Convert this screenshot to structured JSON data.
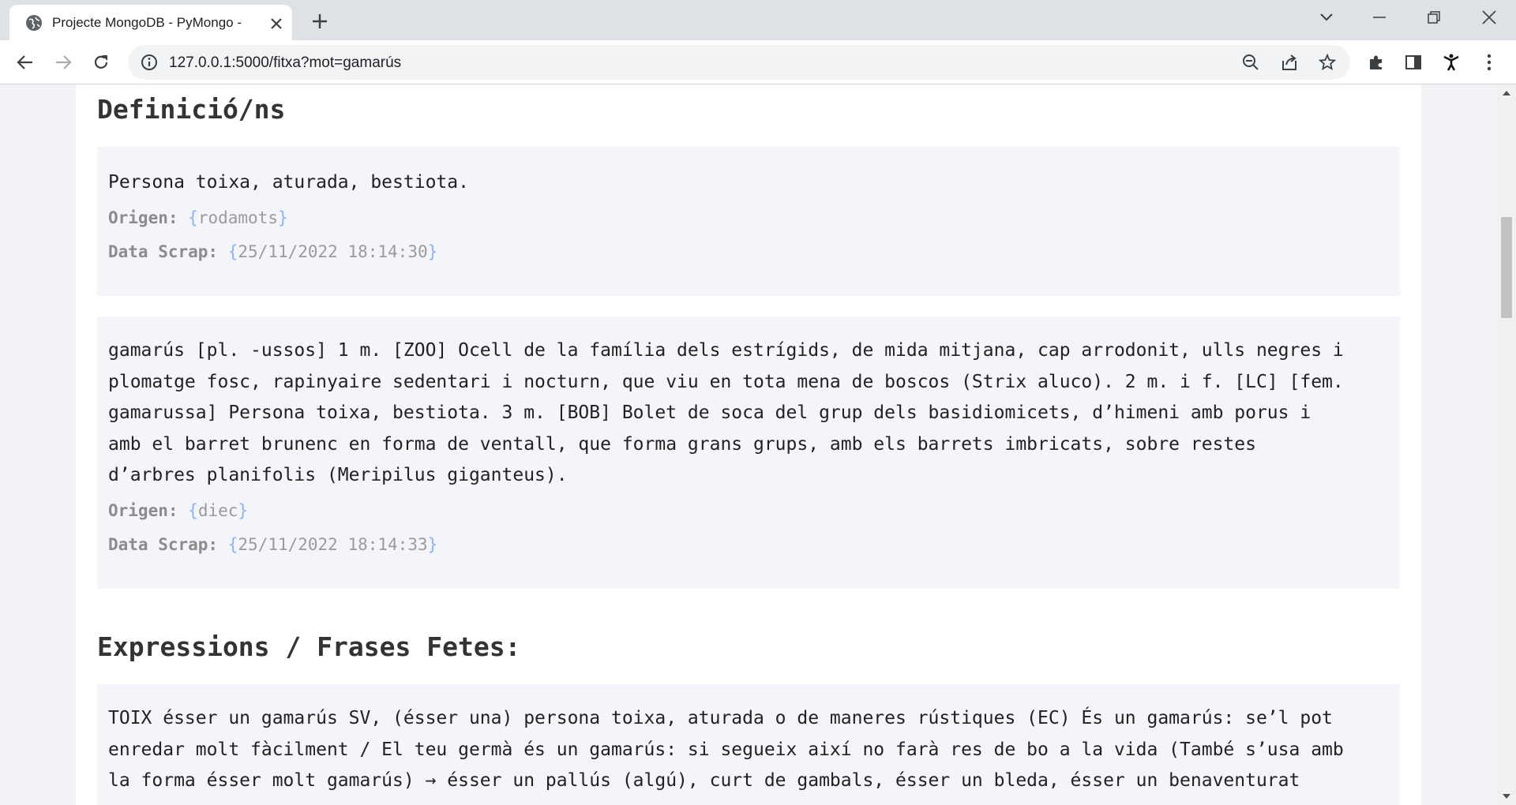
{
  "browser": {
    "tab_title": "Projecte MongoDB - PyMongo - ",
    "url": "127.0.0.1:5000/fitxa?mot=gamarús",
    "icons": {
      "tab_favicon": "globe-icon",
      "tab_close": "close-icon",
      "new_tab": "plus-icon",
      "tab_search": "chevron-down-icon",
      "minimize": "minimize-icon",
      "restore": "restore-icon",
      "close_window": "close-window-icon",
      "back": "back-arrow-icon",
      "forward": "forward-arrow-icon",
      "reload": "reload-icon",
      "site_info": "info-icon",
      "zoom": "zoom-out-icon",
      "share": "share-icon",
      "bookmark": "star-icon",
      "extensions": "puzzle-icon",
      "side_panel": "side-panel-icon",
      "profile": "profile-icon",
      "menu": "kebab-menu-icon"
    }
  },
  "page": {
    "definitions_title": "Definició/ns",
    "definitions": [
      {
        "text": "Persona toixa, aturada, bestiota.",
        "origin_label": "Origen:",
        "origin": "rodamots",
        "date_label": "Data Scrap:",
        "date": "25/11/2022 18:14:30"
      },
      {
        "lines": [
          "gamarús [pl. -ussos] 1 m. [ZOO] Ocell de la família dels estrígids, de mida mitjana, cap arrodonit, ulls negres i",
          "plomatge fosc, rapinyaire sedentari i nocturn, que viu en tota mena de boscos (Strix aluco). 2 m. i f. [LC] [fem.",
          "gamarussa] Persona toixa, bestiota. 3 m. [BOB] Bolet de soca del grup dels basidiomicets, d’himeni amb porus i",
          "amb el barret brunenc en forma de ventall, que forma grans grups, amb els barrets imbricats, sobre restes",
          "d’arbres planifolis (Meripilus giganteus)."
        ],
        "origin_label": "Origen:",
        "origin": "diec",
        "date_label": "Data Scrap:",
        "date": "25/11/2022 18:14:33"
      }
    ],
    "expressions_title": "Expressions / Frases Fetes:",
    "expressions": {
      "lines": [
        "TOIX ésser un gamarús SV, (ésser una) persona toixa, aturada o de maneres rústiques (EC) És un gamarús: se’l pot",
        "enredar molt fàcilment / El teu germà és un gamarús: si segueix així no farà res de bo a la vida (També s’usa amb",
        "la forma ésser molt gamarús) → ésser un pallús (algú), curt de gambals, ésser un bleda, ésser un benaventurat"
      ]
    },
    "brace_open": "{",
    "brace_close": "}"
  },
  "colors": {
    "tab_strip": "#dee1e6",
    "card_bg": "#f4f5fa",
    "meta_brace": "#8ab4f8",
    "meta_text": "#9b9b9b"
  }
}
